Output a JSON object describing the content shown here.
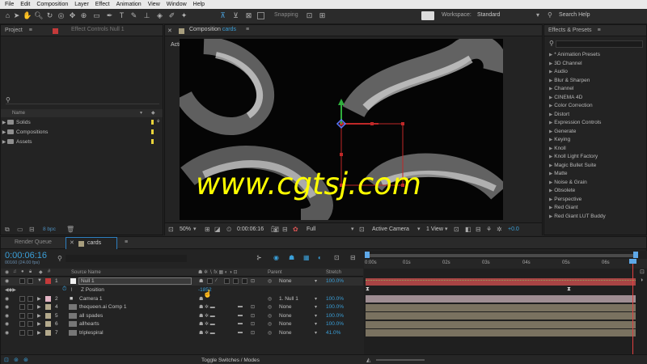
{
  "menu": [
    "File",
    "Edit",
    "Composition",
    "Layer",
    "Effect",
    "Animation",
    "View",
    "Window",
    "Help"
  ],
  "toolbar": {
    "snapping_label": "Snapping",
    "workspace_label": "Workspace:",
    "workspace_value": "Standard",
    "search_help": "Search Help"
  },
  "project": {
    "tab_project": "Project",
    "tab_effect_controls": "Effect Controls Null 1",
    "column_name": "Name",
    "items": [
      "Solids",
      "Compositions",
      "Assets"
    ],
    "bpc": "8 bpc"
  },
  "composition": {
    "tab_prefix": "Composition",
    "tab_name": "cards",
    "camera_label": "Active Camera",
    "watermark": "www.cgtsj.com",
    "zoom": "50%",
    "timecode": "0:00:06:16",
    "resolution": "Full",
    "view_camera": "Active Camera",
    "view_count": "1 View",
    "exposure": "+0.0"
  },
  "effects": {
    "title": "Effects & Presets",
    "items": [
      "* Animation Presets",
      "3D Channel",
      "Audio",
      "Blur & Sharpen",
      "Channel",
      "CINEMA 4D",
      "Color Correction",
      "Distort",
      "Expression Controls",
      "Generate",
      "Keying",
      "Knoll",
      "Knoll Light Factory",
      "Magic Bullet Suite",
      "Matte",
      "Noise & Grain",
      "Obsolete",
      "Perspective",
      "Red Giant",
      "Red Giant LUT Buddy"
    ]
  },
  "timeline": {
    "tab_render": "Render Queue",
    "tab_comp": "cards",
    "timecode": "0:00:06:16",
    "frame_info": "00160 (24.00 fps)",
    "col_source": "Source Name",
    "col_parent": "Parent",
    "col_stretch": "Stretch",
    "ruler": [
      "0:00s",
      "01s",
      "02s",
      "03s",
      "04s",
      "05s",
      "06s"
    ],
    "layers": [
      {
        "num": "1",
        "name": "Null 1",
        "parent": "None",
        "stretch": "100.0%",
        "color": "#c43a3a"
      },
      {
        "num": "2",
        "name": "Camera 1",
        "parent": "1. Null 1",
        "stretch": "100.0%",
        "color": "#e3b5c4"
      },
      {
        "num": "4",
        "name": "thequeen.ai Comp 1",
        "parent": "None",
        "stretch": "100.0%",
        "color": "#b3a98c"
      },
      {
        "num": "5",
        "name": "all spades",
        "parent": "None",
        "stretch": "100.0%",
        "color": "#b3a98c"
      },
      {
        "num": "6",
        "name": "allhearts",
        "parent": "None",
        "stretch": "100.0%",
        "color": "#b3a98c"
      },
      {
        "num": "7",
        "name": "triplespiral",
        "parent": "None",
        "stretch": "41.0%",
        "color": "#b3a98c"
      }
    ],
    "sub_property": "Z Position",
    "sub_value": "-1852",
    "toggle": "Toggle Switches / Modes"
  }
}
